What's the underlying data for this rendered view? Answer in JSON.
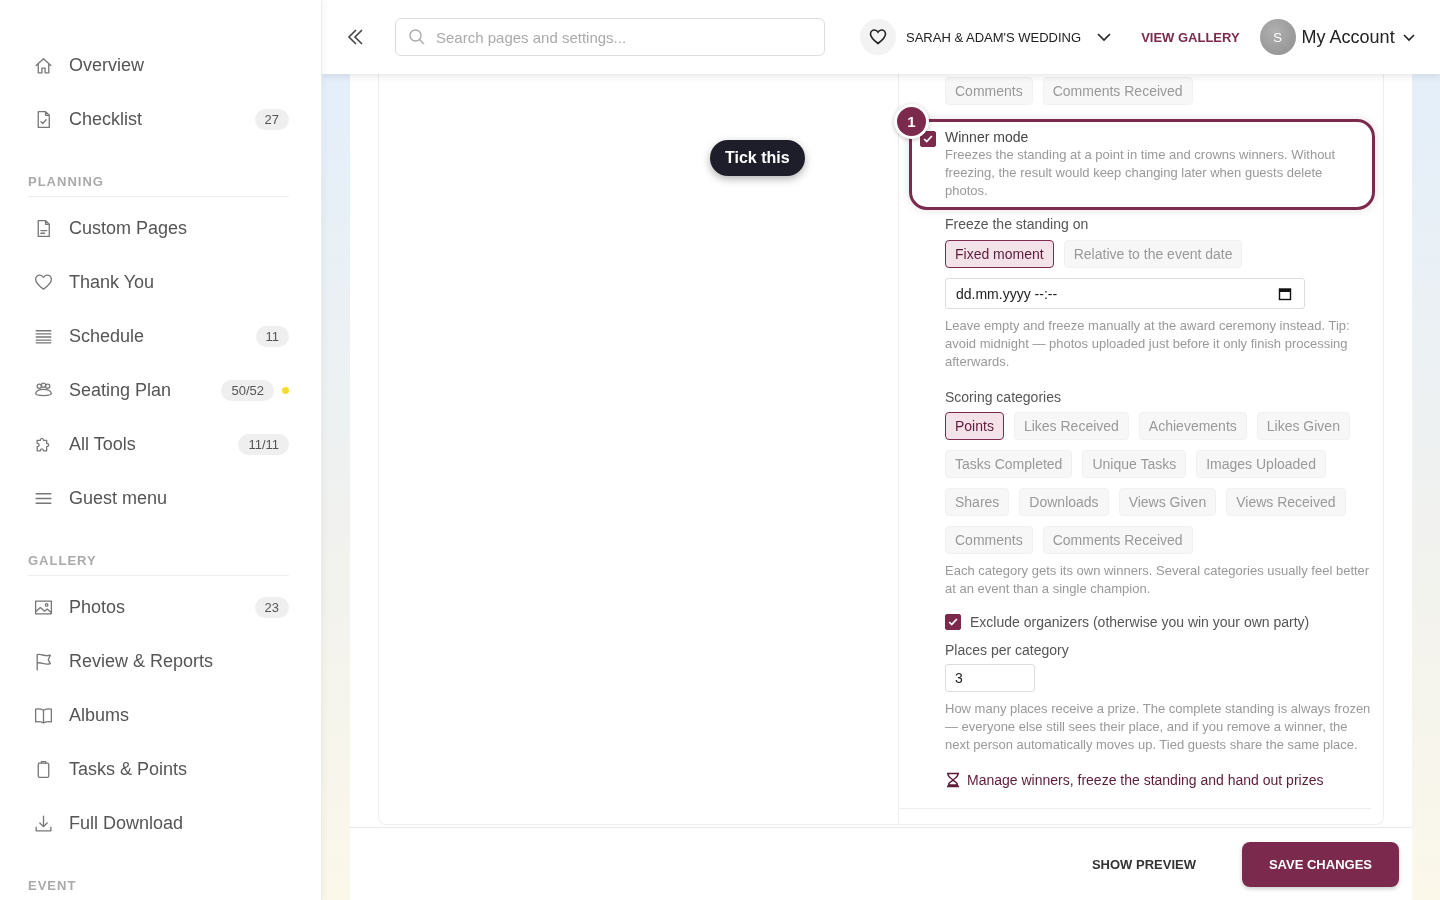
{
  "sidebar": {
    "sections": [
      {
        "items": [
          {
            "label": "Overview"
          },
          {
            "label": "Checklist",
            "count": "27"
          }
        ]
      },
      {
        "heading": "PLANNING",
        "items": [
          {
            "label": "Custom Pages"
          },
          {
            "label": "Thank You"
          },
          {
            "label": "Schedule",
            "count": "11"
          },
          {
            "label": "Seating Plan",
            "count": "50/52",
            "color": "#f7dc2d"
          },
          {
            "label": "All Tools",
            "count": "11/11"
          },
          {
            "label": "Guest menu"
          }
        ]
      },
      {
        "heading": "GALLERY",
        "items": [
          {
            "label": "Photos",
            "count": "23"
          },
          {
            "label": "Review & Reports"
          },
          {
            "label": "Albums"
          },
          {
            "label": "Tasks & Points"
          },
          {
            "label": "Full Download"
          }
        ]
      },
      {
        "heading": "EVENT"
      }
    ]
  },
  "header": {
    "search": {
      "placeholder": "Search pages and settings..."
    },
    "event_name": "SARAH & ADAM'S WEDDING",
    "view_gallery": "VIEW GALLERY",
    "avatar": "S",
    "account": "My Account"
  },
  "tooltip": "Tick this",
  "settings": {
    "top_chips": [
      {
        "label": "Comments",
        "selected": false
      },
      {
        "label": "Comments Received",
        "selected": false
      }
    ],
    "winner_mode": {
      "step": "1",
      "checked": true,
      "title": "Winner mode",
      "description": "Freezes the standing at a point in time and crowns winners. Without freezing, the result would keep changing later when guests delete photos."
    },
    "freeze": {
      "label": "Freeze the standing on",
      "options": [
        {
          "label": "Fixed moment",
          "selected": true
        },
        {
          "label": "Relative to the event date",
          "selected": false
        }
      ],
      "date_field": "dd.mm.yyyy --:--",
      "help": "Leave empty and freeze manually at the award ceremony instead. Tip: avoid midnight — photos uploaded just before it only finish processing afterwards."
    },
    "categories": {
      "label": "Scoring categories",
      "items": [
        {
          "label": "Points",
          "selected": true
        },
        {
          "label": "Likes Received",
          "selected": false
        },
        {
          "label": "Achievements",
          "selected": false
        },
        {
          "label": "Likes Given",
          "selected": false
        },
        {
          "label": "Tasks Completed",
          "selected": false
        },
        {
          "label": "Unique Tasks",
          "selected": false
        },
        {
          "label": "Images Uploaded",
          "selected": false
        },
        {
          "label": "Shares",
          "selected": false
        },
        {
          "label": "Downloads",
          "selected": false
        },
        {
          "label": "Views Given",
          "selected": false
        },
        {
          "label": "Views Received",
          "selected": false
        },
        {
          "label": "Comments",
          "selected": false
        },
        {
          "label": "Comments Received",
          "selected": false
        }
      ],
      "help": "Each category gets its own winners. Several categories usually feel better at an event than a single champion."
    },
    "exclude": {
      "checked": true,
      "label": "Exclude organizers (otherwise you win your own party)"
    },
    "places": {
      "label": "Places per category",
      "value": "3",
      "help": "How many places receive a prize. The complete standing is always frozen — everyone else still sees their place, and if you remove a winner, the next person automatically moves up. Tied guests share the same place."
    },
    "link": "Manage winners, freeze the standing and hand out prizes"
  },
  "footer": {
    "preview": "SHOW PREVIEW",
    "save": "SAVE CHANGES"
  }
}
